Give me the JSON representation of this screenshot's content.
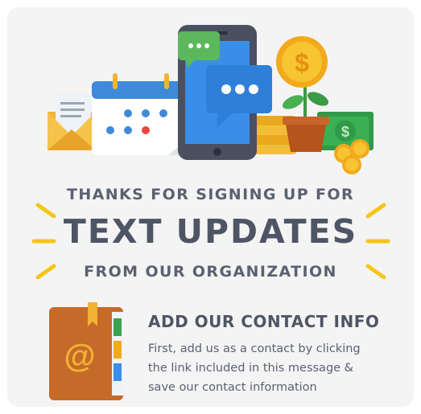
{
  "header": {
    "line1": "THANKS FOR SIGNING UP FOR",
    "line2": "TEXT UPDATES",
    "line3": "FROM OUR ORGANIZATION"
  },
  "contact": {
    "title": "ADD OUR CONTACT INFO",
    "body_lines": [
      "First, add us as a contact by clicking",
      "the link included in this message &",
      "save our contact information"
    ]
  },
  "icons": [
    "envelope-icon",
    "calendar-icon",
    "phone-icon",
    "chat-bubble-icon",
    "coin-icon",
    "plant-icon",
    "money-icon",
    "address-book-icon"
  ],
  "colors": {
    "accent": "#f5c518",
    "text": "#4e5564",
    "book": "#c66a2a",
    "money": "#3aa24f",
    "phone_screen": "#3b8ee8"
  }
}
